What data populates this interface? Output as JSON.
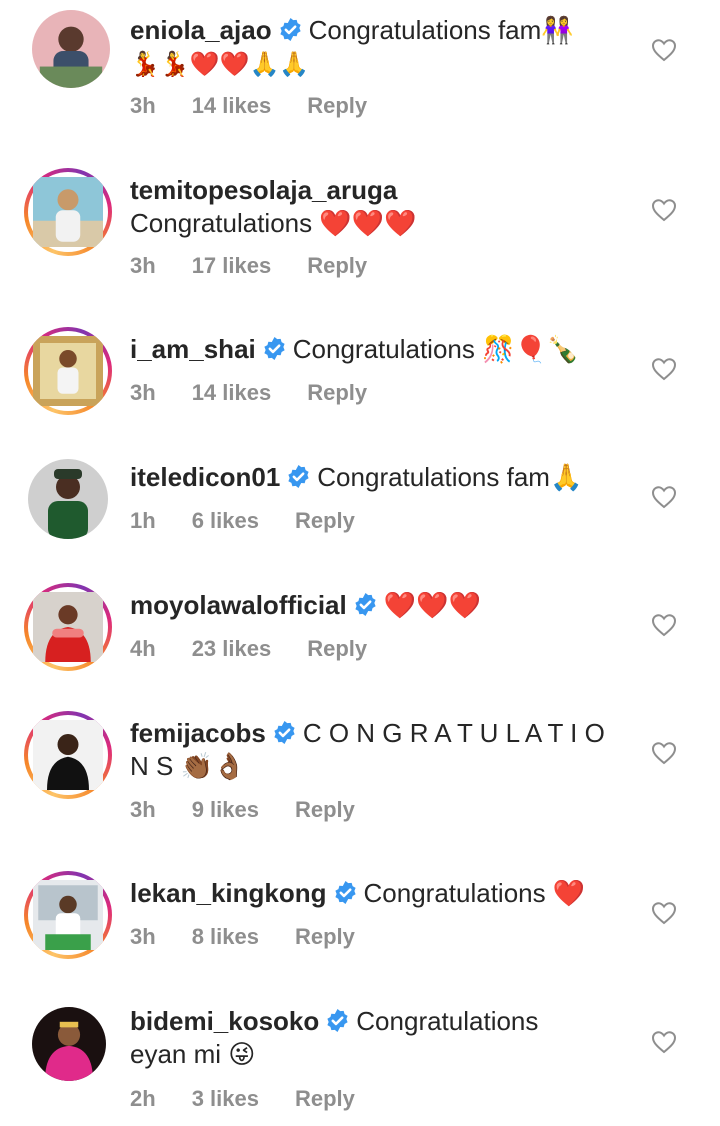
{
  "comments": [
    {
      "username": "eniola_ajao",
      "verified": true,
      "story_ring": false,
      "text": "Congratulations fam👭",
      "text2": "💃💃❤️❤️🙏🙏",
      "time": "3h",
      "likes": "14 likes",
      "reply": "Reply"
    },
    {
      "username": "temitopesolaja_aruga",
      "verified": false,
      "story_ring": true,
      "text": "Congratulations ❤️❤️❤️",
      "time": "3h",
      "likes": "17 likes",
      "reply": "Reply"
    },
    {
      "username": "i_am_shai",
      "verified": true,
      "story_ring": true,
      "text": "Congratulations 🎊🎈🍾",
      "time": "3h",
      "likes": "14 likes",
      "reply": "Reply"
    },
    {
      "username": "iteledicon01",
      "verified": true,
      "story_ring": false,
      "text": "Congratulations fam🙏",
      "time": "1h",
      "likes": "6 likes",
      "reply": "Reply"
    },
    {
      "username": "moyolawalofficial",
      "verified": true,
      "story_ring": true,
      "text": "❤️❤️❤️",
      "time": "4h",
      "likes": "23 likes",
      "reply": "Reply"
    },
    {
      "username": "femijacobs",
      "verified": true,
      "story_ring": true,
      "text": "C O N G R A T U L A T I O",
      "text2": "N S 👏🏾👌🏾",
      "time": "3h",
      "likes": "9 likes",
      "reply": "Reply"
    },
    {
      "username": "lekan_kingkong",
      "verified": true,
      "story_ring": true,
      "text": "Congratulations ❤️",
      "time": "3h",
      "likes": "8 likes",
      "reply": "Reply"
    },
    {
      "username": "bidemi_kosoko",
      "verified": true,
      "story_ring": false,
      "text": "Congratulations",
      "text2": "eyan mi 😜",
      "time": "2h",
      "likes": "3 likes",
      "reply": "Reply"
    }
  ],
  "colors": {
    "text": "#262626",
    "meta": "#8e8e8e",
    "verified_blue": "#3897f0",
    "heart_outline": "#8e8e8e"
  },
  "icons": {
    "verified": "verified-badge-icon",
    "like": "heart-outline-icon"
  }
}
